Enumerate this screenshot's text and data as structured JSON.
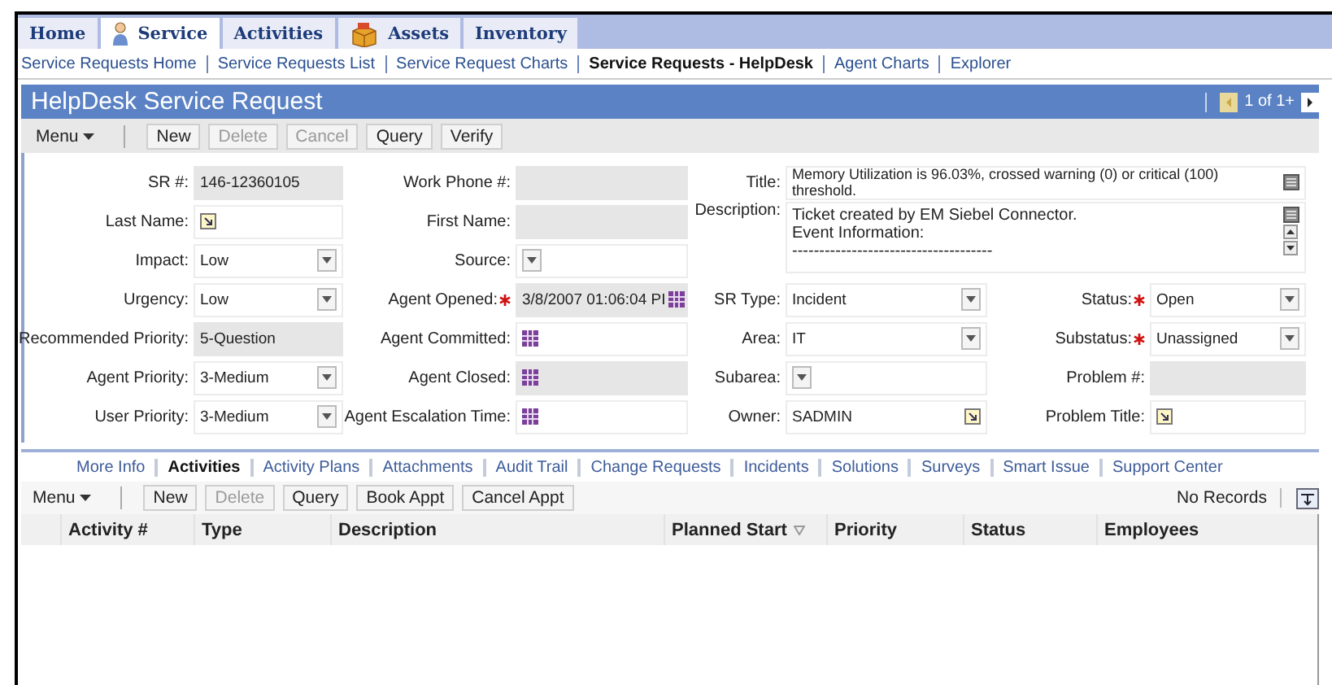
{
  "nav_tabs": [
    {
      "label": "Home",
      "selected": false
    },
    {
      "label": "Service",
      "kind": "person",
      "selected": true
    },
    {
      "label": "Activities",
      "selected": false
    },
    {
      "label": "Assets",
      "kind": "box",
      "selected": false
    },
    {
      "label": "Inventory",
      "selected": false
    }
  ],
  "sub_nav": [
    {
      "label": "Service Requests Home",
      "selected": false
    },
    {
      "label": "Service Requests List",
      "selected": false
    },
    {
      "label": "Service Request Charts",
      "selected": false
    },
    {
      "label": "Service Requests - HelpDesk",
      "selected": true
    },
    {
      "label": "Agent Charts",
      "selected": false
    },
    {
      "label": "Explorer",
      "selected": false
    }
  ],
  "applet": {
    "title": "HelpDesk Service Request",
    "record_count": "1 of 1+",
    "previous_disabled": true,
    "next_disabled": false,
    "toolbar": [
      {
        "label": "Menu",
        "kind": "menu"
      },
      {
        "label": "New",
        "kind": "button",
        "disabled": false
      },
      {
        "label": "Delete",
        "kind": "button",
        "disabled": true
      },
      {
        "label": "Cancel",
        "kind": "button",
        "disabled": true
      },
      {
        "label": "Query",
        "kind": "button",
        "disabled": false
      },
      {
        "label": "Verify",
        "kind": "button",
        "disabled": false
      }
    ]
  },
  "form": {
    "column_1": [
      {
        "label": "SR #:",
        "value": "146-12360105",
        "kind": "text",
        "readonly": true,
        "required": false
      },
      {
        "label": "Last Name:",
        "kind": "pick",
        "readonly": false,
        "required": false
      },
      {
        "label": "Impact:",
        "value": "Low",
        "kind": "select",
        "readonly": false,
        "required": false
      },
      {
        "label": "Urgency:",
        "value": "Low",
        "kind": "select",
        "readonly": false,
        "required": false
      },
      {
        "label": "Recommended Priority:",
        "value": "5-Question",
        "kind": "text",
        "readonly": true,
        "required": false
      },
      {
        "label": "Agent Priority:",
        "value": "3-Medium",
        "kind": "select",
        "readonly": false,
        "required": false
      },
      {
        "label": "User Priority:",
        "value": "3-Medium",
        "kind": "select",
        "readonly": false,
        "required": false
      }
    ],
    "column_2": [
      {
        "label": "Work Phone #:",
        "kind": "text",
        "readonly": true,
        "required": false
      },
      {
        "label": "First Name:",
        "kind": "text",
        "readonly": true,
        "required": false
      },
      {
        "label": "Source:",
        "kind": "select",
        "readonly": false,
        "required": false
      },
      {
        "label": "Agent Opened:",
        "value": "3/8/2007 01:06:04 PI",
        "kind": "date",
        "readonly": true,
        "required": true
      },
      {
        "label": "Agent Committed:",
        "kind": "date",
        "readonly": false,
        "required": false
      },
      {
        "label": "Agent Closed:",
        "kind": "date",
        "readonly": true,
        "required": false
      },
      {
        "label": "Agent Escalation Time:",
        "kind": "date",
        "readonly": false,
        "required": false
      }
    ],
    "wide": [
      {
        "label": "Title:",
        "value": "Memory Utilization is 96.03%, crossed warning (0) or critical (100) threshold.",
        "kind": "expand",
        "readonly": false,
        "required": false
      },
      {
        "label": "Description:",
        "value": "Ticket created by EM Siebel Connector.\nEvent Information:\n-------------------------------------",
        "kind": "textarea",
        "readonly": false,
        "required": false
      }
    ],
    "column_3": [
      {
        "label": "SR Type:",
        "value": "Incident",
        "kind": "select",
        "readonly": false,
        "required": false
      },
      {
        "label": "Area:",
        "value": "IT",
        "kind": "select",
        "readonly": false,
        "required": false
      },
      {
        "label": "Subarea:",
        "kind": "select",
        "readonly": false,
        "required": false
      },
      {
        "label": "Owner:",
        "value": "SADMIN",
        "kind": "pick",
        "readonly": false,
        "required": false
      }
    ],
    "column_4": [
      {
        "label": "Status:",
        "value": "Open",
        "kind": "select",
        "readonly": false,
        "required": true
      },
      {
        "label": "Substatus:",
        "value": "Unassigned",
        "kind": "select",
        "readonly": false,
        "required": true
      },
      {
        "label": "Problem #:",
        "kind": "text",
        "readonly": true,
        "required": false
      },
      {
        "label": "Problem Title:",
        "kind": "pick",
        "readonly": false,
        "required": false
      }
    ]
  },
  "detail_tabs": [
    {
      "label": "More Info",
      "selected": false
    },
    {
      "label": "Activities",
      "selected": true
    },
    {
      "label": "Activity Plans",
      "selected": false
    },
    {
      "label": "Attachments",
      "selected": false
    },
    {
      "label": "Audit Trail",
      "selected": false
    },
    {
      "label": "Change Requests",
      "selected": false
    },
    {
      "label": "Incidents",
      "selected": false
    },
    {
      "label": "Solutions",
      "selected": false
    },
    {
      "label": "Surveys",
      "selected": false
    },
    {
      "label": "Smart Issue",
      "selected": false
    },
    {
      "label": "Support Center",
      "selected": false
    }
  ],
  "list": {
    "record_status": "No Records",
    "toolbar": [
      {
        "label": "Menu",
        "kind": "menu"
      },
      {
        "label": "New",
        "kind": "button",
        "disabled": false
      },
      {
        "label": "Delete",
        "kind": "button",
        "disabled": true
      },
      {
        "label": "Query",
        "kind": "button",
        "disabled": false
      },
      {
        "label": "Book Appt",
        "kind": "button",
        "disabled": false
      },
      {
        "label": "Cancel Appt",
        "kind": "button",
        "disabled": false
      }
    ],
    "columns": [
      {
        "label": "Activity #",
        "sorted": false
      },
      {
        "label": "Type",
        "sorted": false
      },
      {
        "label": "Description",
        "sorted": false
      },
      {
        "label": "Planned Start",
        "sorted": true
      },
      {
        "label": "Priority",
        "sorted": false
      },
      {
        "label": "Status",
        "sorted": false
      },
      {
        "label": "Employees",
        "sorted": false
      }
    ]
  }
}
